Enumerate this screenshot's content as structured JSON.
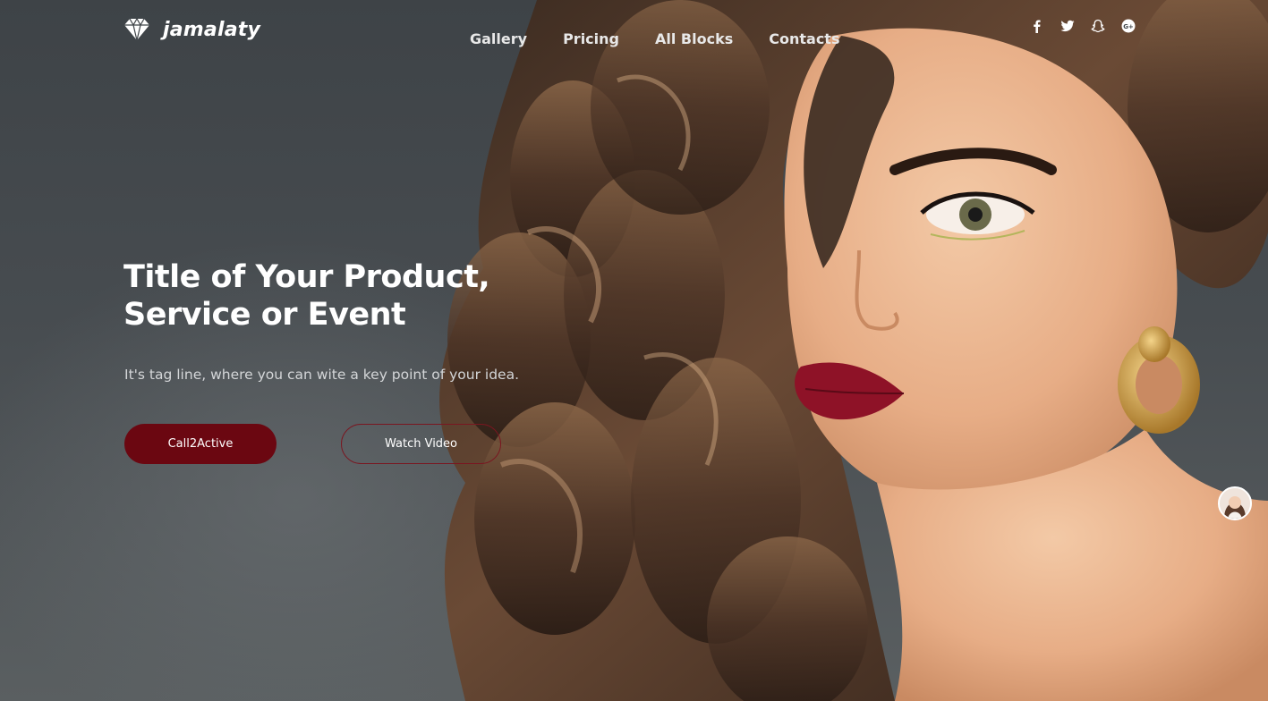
{
  "brand": {
    "name": "jamalaty",
    "icon": "diamond-icon"
  },
  "nav": {
    "items": [
      {
        "label": "Gallery"
      },
      {
        "label": "Pricing"
      },
      {
        "label": "All Blocks"
      },
      {
        "label": "Contacts"
      }
    ]
  },
  "social": [
    "facebook-icon",
    "twitter-icon",
    "snapchat-icon",
    "google-plus-icon"
  ],
  "hero": {
    "title_line1": "Title of Your Product,",
    "title_line2": "Service or Event",
    "tagline": "It's tag line, where you can wite a key point of your idea.",
    "primary_button": "Call2Active",
    "secondary_button": "Watch Video"
  },
  "colors": {
    "accent": "#6b0711",
    "background": "#3f4448",
    "text": "#ffffff"
  }
}
